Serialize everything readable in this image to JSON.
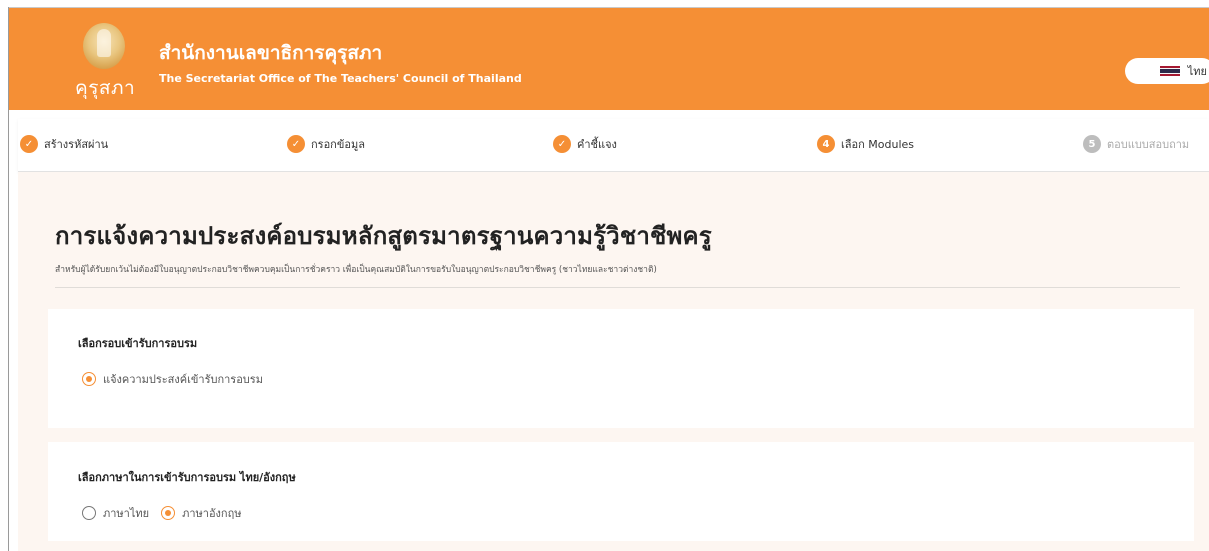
{
  "header": {
    "logo_text": "คุรุสภา",
    "org_name_th": "สำนักงานเลขาธิการคุรุสภา",
    "org_name_en": "The Secretariat Office of The Teachers' Council of Thailand",
    "language": {
      "label": "ไทย",
      "flag_icon": "thai-flag-icon"
    },
    "color": "#f58f35"
  },
  "steps": [
    {
      "label": "สร้างรหัสผ่าน",
      "state": "done",
      "icon": "check-icon"
    },
    {
      "label": "กรอกข้อมูล",
      "state": "done",
      "icon": "check-icon"
    },
    {
      "label": "คำชี้แจง",
      "state": "done",
      "icon": "check-icon"
    },
    {
      "number": "4",
      "label": "เลือก Modules",
      "state": "active"
    },
    {
      "number": "5",
      "label": "ตอบแบบสอบถาม",
      "state": "pending"
    }
  ],
  "page": {
    "title": "การแจ้งความประสงค์อบรมหลักสูตรมาตรฐานความรู้วิชาชีพครู",
    "subtitle": "สำหรับผู้ได้รับยกเว้นไม่ต้องมีใบอนุญาตประกอบวิชาชีพควบคุมเป็นการชั่วคราว เพื่อเป็นคุณสมบัติในการขอรับใบอนุญาตประกอบวิชาชีพครู (ชาวไทยและชาวต่างชาติ)"
  },
  "sections": {
    "round": {
      "title": "เลือกรอบเข้ารับการอบรม",
      "options": [
        {
          "label": "แจ้งความประสงค์เข้ารับการอบรม",
          "checked": true
        }
      ]
    },
    "language": {
      "title": "เลือกภาษาในการเข้ารับการอบรม ไทย/อังกฤษ",
      "options": [
        {
          "label": "ภาษาไทย",
          "checked": false
        },
        {
          "label": "ภาษาอังกฤษ",
          "checked": true
        }
      ]
    }
  }
}
